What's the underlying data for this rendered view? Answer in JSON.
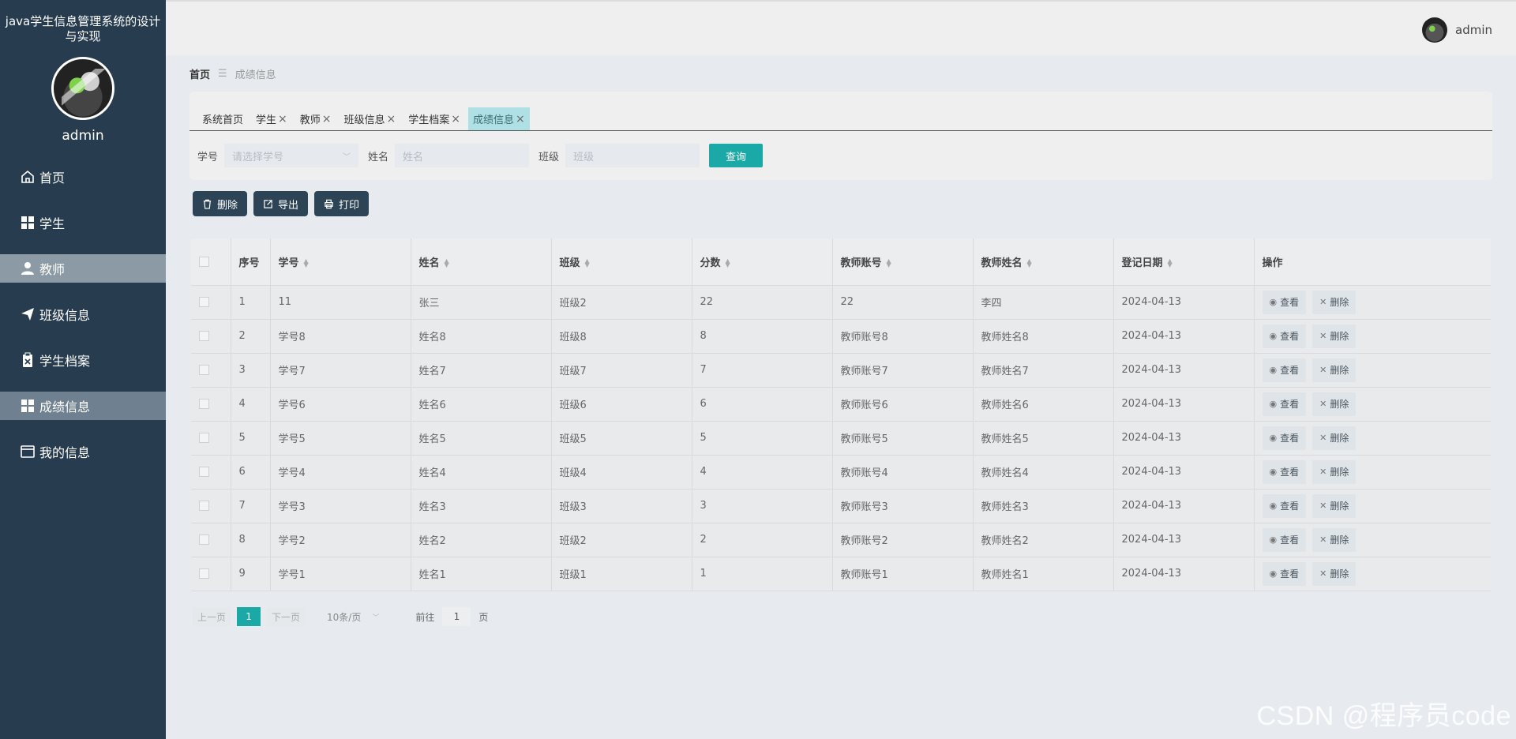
{
  "app": {
    "title": "java学生信息管理系统的设计与实现",
    "username": "admin"
  },
  "topbar": {
    "username": "admin"
  },
  "sidebar": {
    "items": [
      {
        "label": "首页",
        "icon": "home-icon"
      },
      {
        "label": "学生",
        "icon": "grid-icon"
      },
      {
        "label": "教师",
        "icon": "user-icon"
      },
      {
        "label": "班级信息",
        "icon": "send-icon"
      },
      {
        "label": "学生档案",
        "icon": "clipboard-icon"
      },
      {
        "label": "成绩信息",
        "icon": "grid-icon"
      },
      {
        "label": "我的信息",
        "icon": "card-icon"
      }
    ]
  },
  "breadcrumb": {
    "home": "首页",
    "separator": "☰",
    "current": "成绩信息"
  },
  "tabs": [
    {
      "label": "系统首页",
      "closable": false
    },
    {
      "label": "学生",
      "closable": true
    },
    {
      "label": "教师",
      "closable": true
    },
    {
      "label": "班级信息",
      "closable": true
    },
    {
      "label": "学生档案",
      "closable": true
    },
    {
      "label": "成绩信息",
      "closable": true,
      "active": true
    }
  ],
  "filters": {
    "xuehao_label": "学号",
    "xuehao_placeholder": "请选择学号",
    "name_label": "姓名",
    "name_placeholder": "姓名",
    "class_label": "班级",
    "class_placeholder": "班级",
    "query_label": "查询"
  },
  "actions": {
    "delete": "删除",
    "export": "导出",
    "print": "打印"
  },
  "table": {
    "headers": [
      "序号",
      "学号",
      "姓名",
      "班级",
      "分数",
      "教师账号",
      "教师姓名",
      "登记日期",
      "操作"
    ],
    "rows": [
      [
        "1",
        "11",
        "张三",
        "班级2",
        "22",
        "22",
        "李四",
        "2024-04-13"
      ],
      [
        "2",
        "学号8",
        "姓名8",
        "班级8",
        "8",
        "教师账号8",
        "教师姓名8",
        "2024-04-13"
      ],
      [
        "3",
        "学号7",
        "姓名7",
        "班级7",
        "7",
        "教师账号7",
        "教师姓名7",
        "2024-04-13"
      ],
      [
        "4",
        "学号6",
        "姓名6",
        "班级6",
        "6",
        "教师账号6",
        "教师姓名6",
        "2024-04-13"
      ],
      [
        "5",
        "学号5",
        "姓名5",
        "班级5",
        "5",
        "教师账号5",
        "教师姓名5",
        "2024-04-13"
      ],
      [
        "6",
        "学号4",
        "姓名4",
        "班级4",
        "4",
        "教师账号4",
        "教师姓名4",
        "2024-04-13"
      ],
      [
        "7",
        "学号3",
        "姓名3",
        "班级3",
        "3",
        "教师账号3",
        "教师姓名3",
        "2024-04-13"
      ],
      [
        "8",
        "学号2",
        "姓名2",
        "班级2",
        "2",
        "教师账号2",
        "教师姓名2",
        "2024-04-13"
      ],
      [
        "9",
        "学号1",
        "姓名1",
        "班级1",
        "1",
        "教师账号1",
        "教师姓名1",
        "2024-04-13"
      ]
    ],
    "view_label": "查看",
    "delete_label": "删除"
  },
  "pagination": {
    "prev": "上一页",
    "current": "1",
    "next": "下一页",
    "page_size": "10条/页",
    "goto_prefix": "前往",
    "goto_value": "1",
    "goto_suffix": "页"
  },
  "watermark": "CSDN @程序员code",
  "colors": {
    "sidebar": "#273c4e",
    "accent": "#1aa9a6",
    "active_tab": "#aee0e6"
  }
}
